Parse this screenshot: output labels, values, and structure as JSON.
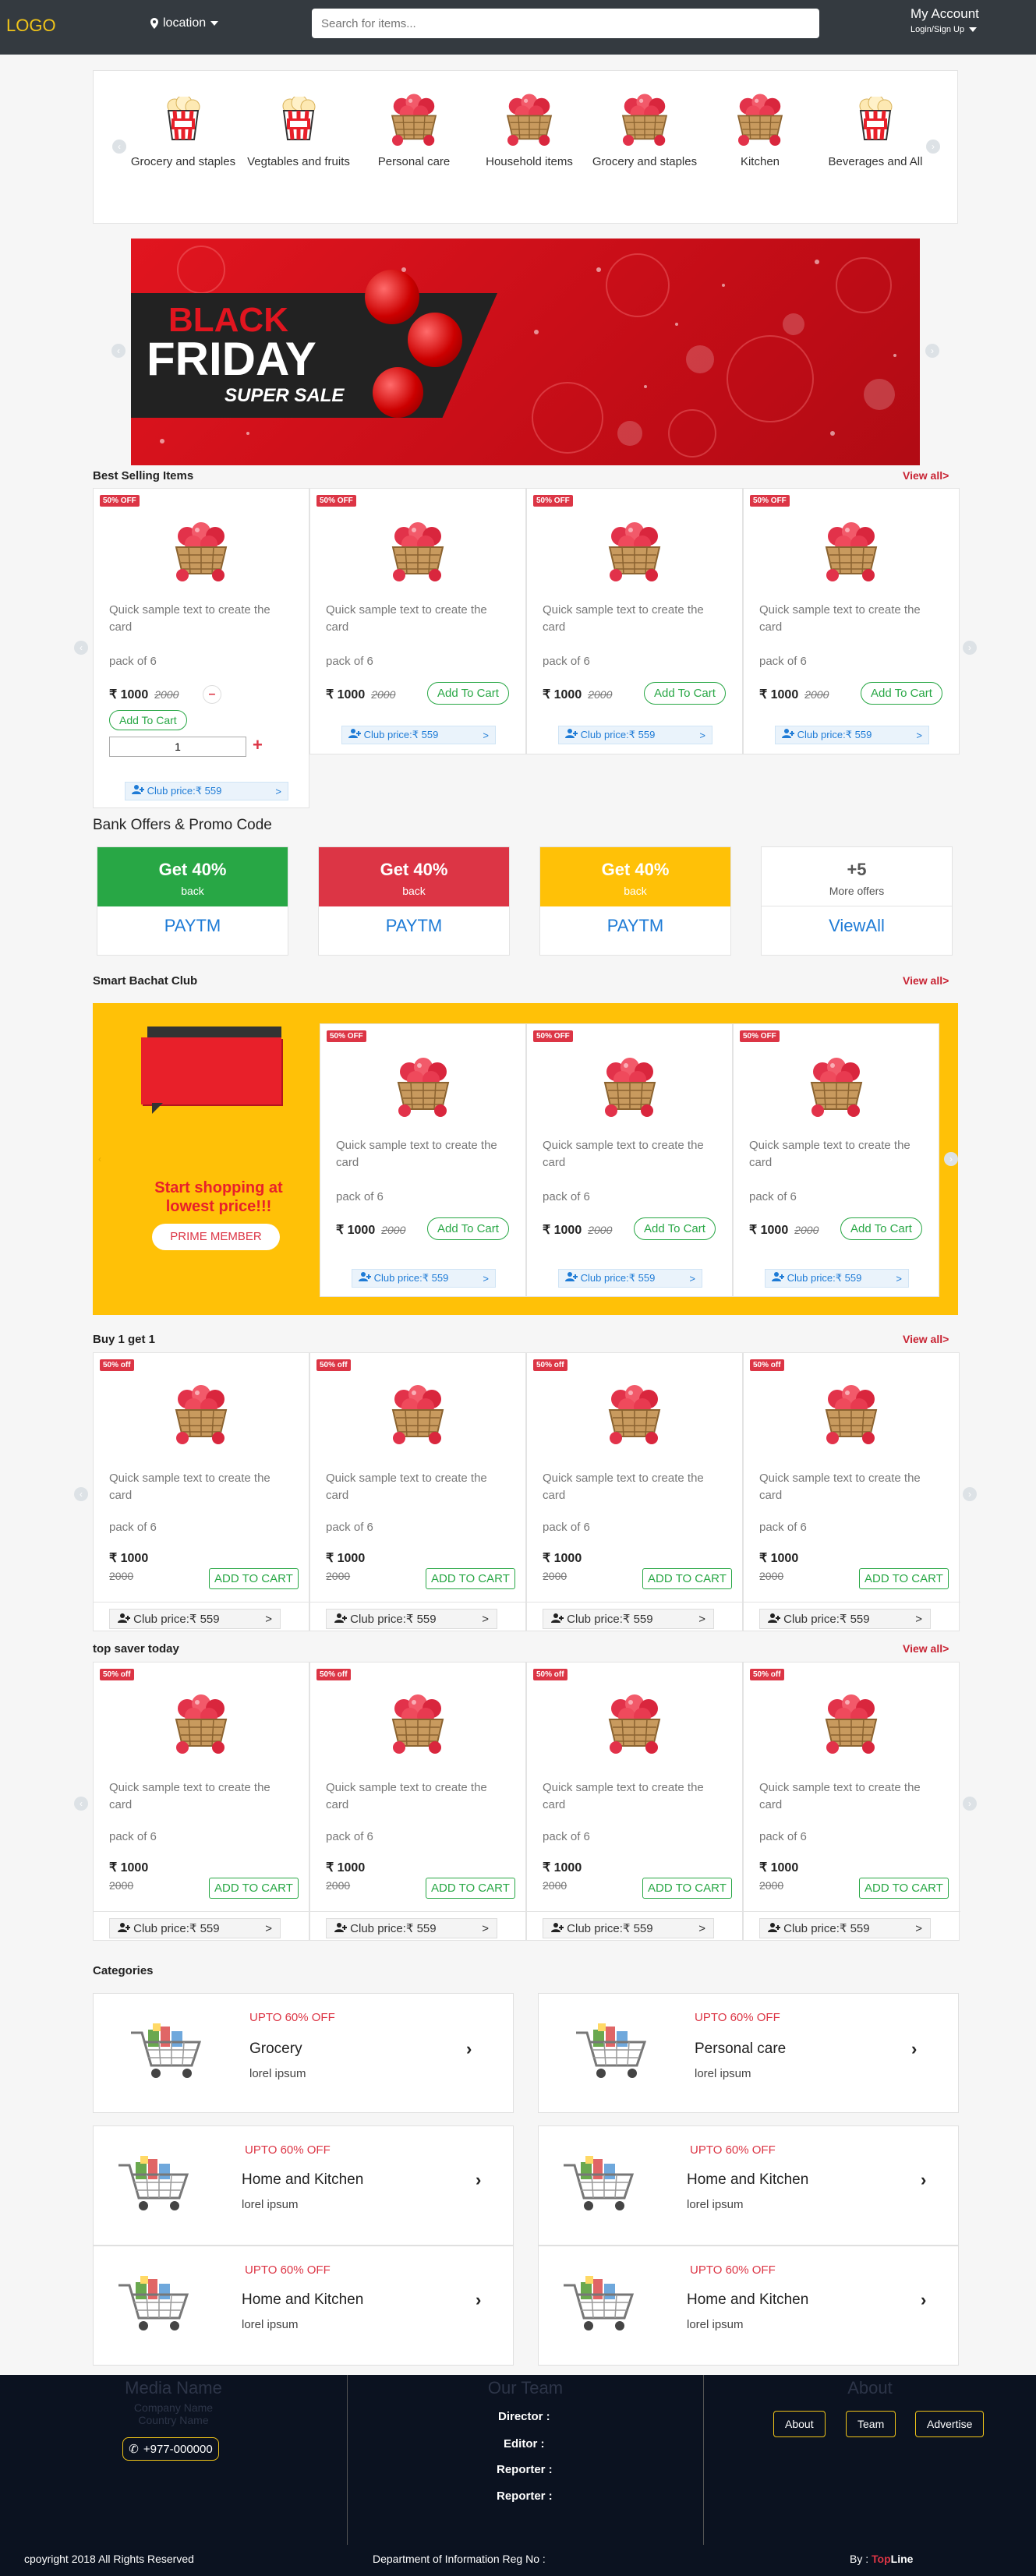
{
  "header": {
    "logo": "LOGO",
    "location": "location",
    "search_placeholder": "Search for items...",
    "account_title": "My Account",
    "account_sub": "Login/Sign Up"
  },
  "top_categories": [
    {
      "label": "Grocery and staples",
      "icon": "popcorn-icon"
    },
    {
      "label": "Vegtables and fruits",
      "icon": "popcorn-icon"
    },
    {
      "label": "Personal care",
      "icon": "apple-basket-icon"
    },
    {
      "label": "Household items",
      "icon": "apple-basket-icon"
    },
    {
      "label": "Grocery and staples",
      "icon": "apple-basket-icon"
    },
    {
      "label": "Kitchen",
      "icon": "apple-basket-icon"
    },
    {
      "label": "Beverages and All",
      "icon": "popcorn-icon"
    }
  ],
  "banner": {
    "line1": "BLACK",
    "line2": "FRIDAY",
    "line3": "SUPER SALE"
  },
  "best_selling": {
    "title": "Best Selling Items",
    "view_all": "View all>",
    "products": [
      {
        "badge": "50% OFF",
        "desc": "Quick sample text to create the card",
        "pack": "pack of 6",
        "price": "₹ 1000",
        "old": "2000",
        "add": "Add To Cart",
        "club": "Club price:₹ 559",
        "qty": "1",
        "minus": "–",
        "plus": "+",
        "go": ">"
      },
      {
        "badge": "50% OFF",
        "desc": "Quick sample text to create the card",
        "pack": "pack of 6",
        "price": "₹ 1000",
        "old": "2000",
        "add": "Add To Cart",
        "club": "Club price:₹ 559",
        "go": ">"
      },
      {
        "badge": "50% OFF",
        "desc": "Quick sample text to create the card",
        "pack": "pack of 6",
        "price": "₹ 1000",
        "old": "2000",
        "add": "Add To Cart",
        "club": "Club price:₹ 559",
        "go": ">"
      },
      {
        "badge": "50% OFF",
        "desc": "Quick sample text to create the card",
        "pack": "pack of 6",
        "price": "₹ 1000",
        "old": "2000",
        "add": "Add To Cart",
        "club": "Club price:₹ 559",
        "go": ">"
      }
    ]
  },
  "bank_offers": {
    "title": "Bank Offers & Promo Code",
    "items": [
      {
        "line1": "Get 40%",
        "line2": "back",
        "name": "PAYTM",
        "color": "#28a745"
      },
      {
        "line1": "Get 40%",
        "line2": "back",
        "name": "PAYTM",
        "color": "#dc3545"
      },
      {
        "line1": "Get 40%",
        "line2": "back",
        "name": "PAYTM",
        "color": "#ffc107"
      }
    ],
    "more": {
      "count": "+5",
      "label": "More offers",
      "name": "ViewAll"
    }
  },
  "bachat": {
    "title": "Smart Bachat Club",
    "view_all": "View all>",
    "promo": "Start shopping at lowest price!!!",
    "member_btn": "PRIME MEMBER",
    "products": [
      {
        "badge": "50% OFF",
        "desc": "Quick sample text to create the card",
        "pack": "pack of 6",
        "price": "₹ 1000",
        "old": "2000",
        "add": "Add To Cart",
        "club": "Club price:₹ 559",
        "go": ">"
      },
      {
        "badge": "50% OFF",
        "desc": "Quick sample text to create the card",
        "pack": "pack of 6",
        "price": "₹ 1000",
        "old": "2000",
        "add": "Add To Cart",
        "club": "Club price:₹ 559",
        "go": ">"
      },
      {
        "badge": "50% OFF",
        "desc": "Quick sample text to create the card",
        "pack": "pack of 6",
        "price": "₹ 1000",
        "old": "2000",
        "add": "Add To Cart",
        "club": "Club price:₹ 559",
        "go": ">"
      }
    ]
  },
  "buy1": {
    "title": "Buy 1 get 1",
    "view_all": "View all>",
    "products": [
      {
        "badge": "50% off",
        "desc": "Quick sample text to create the card",
        "pack": "pack of 6",
        "price": "₹ 1000",
        "old": "2000",
        "add": "ADD TO CART",
        "club": "Club price:₹ 559",
        "go": ">"
      },
      {
        "badge": "50% off",
        "desc": "Quick sample text to create the card",
        "pack": "pack of 6",
        "price": "₹ 1000",
        "old": "2000",
        "add": "ADD TO CART",
        "club": "Club price:₹ 559",
        "go": ">"
      },
      {
        "badge": "50% off",
        "desc": "Quick sample text to create the card",
        "pack": "pack of 6",
        "price": "₹ 1000",
        "old": "2000",
        "add": "ADD TO CART",
        "club": "Club price:₹ 559",
        "go": ">"
      },
      {
        "badge": "50% off",
        "desc": "Quick sample text to create the card",
        "pack": "pack of 6",
        "price": "₹ 1000",
        "old": "2000",
        "add": "ADD TO CART",
        "club": "Club price:₹ 559",
        "go": ">"
      }
    ]
  },
  "topsaver": {
    "title": "top saver today",
    "view_all": "View all>",
    "products": [
      {
        "badge": "50% off",
        "desc": "Quick sample text to create the card",
        "pack": "pack of 6",
        "price": "₹ 1000",
        "old": "2000",
        "add": "ADD TO CART",
        "club": "Club price:₹ 559",
        "go": ">"
      },
      {
        "badge": "50% off",
        "desc": "Quick sample text to create the card",
        "pack": "pack of 6",
        "price": "₹ 1000",
        "old": "2000",
        "add": "ADD TO CART",
        "club": "Club price:₹ 559",
        "go": ">"
      },
      {
        "badge": "50% off",
        "desc": "Quick sample text to create the card",
        "pack": "pack of 6",
        "price": "₹ 1000",
        "old": "2000",
        "add": "ADD TO CART",
        "club": "Club price:₹ 559",
        "go": ">"
      },
      {
        "badge": "50% off",
        "desc": "Quick sample text to create the card",
        "pack": "pack of 6",
        "price": "₹ 1000",
        "old": "2000",
        "add": "ADD TO CART",
        "club": "Club price:₹ 559",
        "go": ">"
      }
    ]
  },
  "categories": {
    "title": "Categories",
    "items": [
      {
        "offer": "UPTO 60% OFF",
        "name": "Grocery",
        "sub": "lorel ipsum"
      },
      {
        "offer": "UPTO 60% OFF",
        "name": "Personal care",
        "sub": "lorel ipsum"
      },
      {
        "offer": "UPTO 60% OFF",
        "name": "Home and Kitchen",
        "sub": "lorel ipsum"
      },
      {
        "offer": "UPTO 60% OFF",
        "name": "Home and Kitchen",
        "sub": "lorel ipsum"
      },
      {
        "offer": "UPTO 60% OFF",
        "name": "Home and Kitchen",
        "sub": "lorel ipsum"
      },
      {
        "offer": "UPTO 60% OFF",
        "name": "Home and Kitchen",
        "sub": "lorel ipsum"
      }
    ]
  },
  "footer": {
    "media_title": "Media Name",
    "company": "Company Name",
    "country": "Country Name",
    "phone": "+977-000000",
    "team_title": "Our Team",
    "team": [
      "Director :",
      "Editor :",
      "Reporter :",
      "Reporter :"
    ],
    "about_title": "About",
    "about_links": [
      "About",
      "Team",
      "Advertise"
    ],
    "copyright": "cpoyright 2018 All Rights Reserved",
    "reg": "Department of Information Reg No :",
    "by": "By :",
    "brand_a": "Top",
    "brand_b": "Line"
  },
  "colors": {
    "accent": "#f0c419",
    "offer_red": "#dc3545",
    "green": "#28a745",
    "yellow_bg": "#ffc107",
    "club_blue": "#1e7bd6"
  }
}
